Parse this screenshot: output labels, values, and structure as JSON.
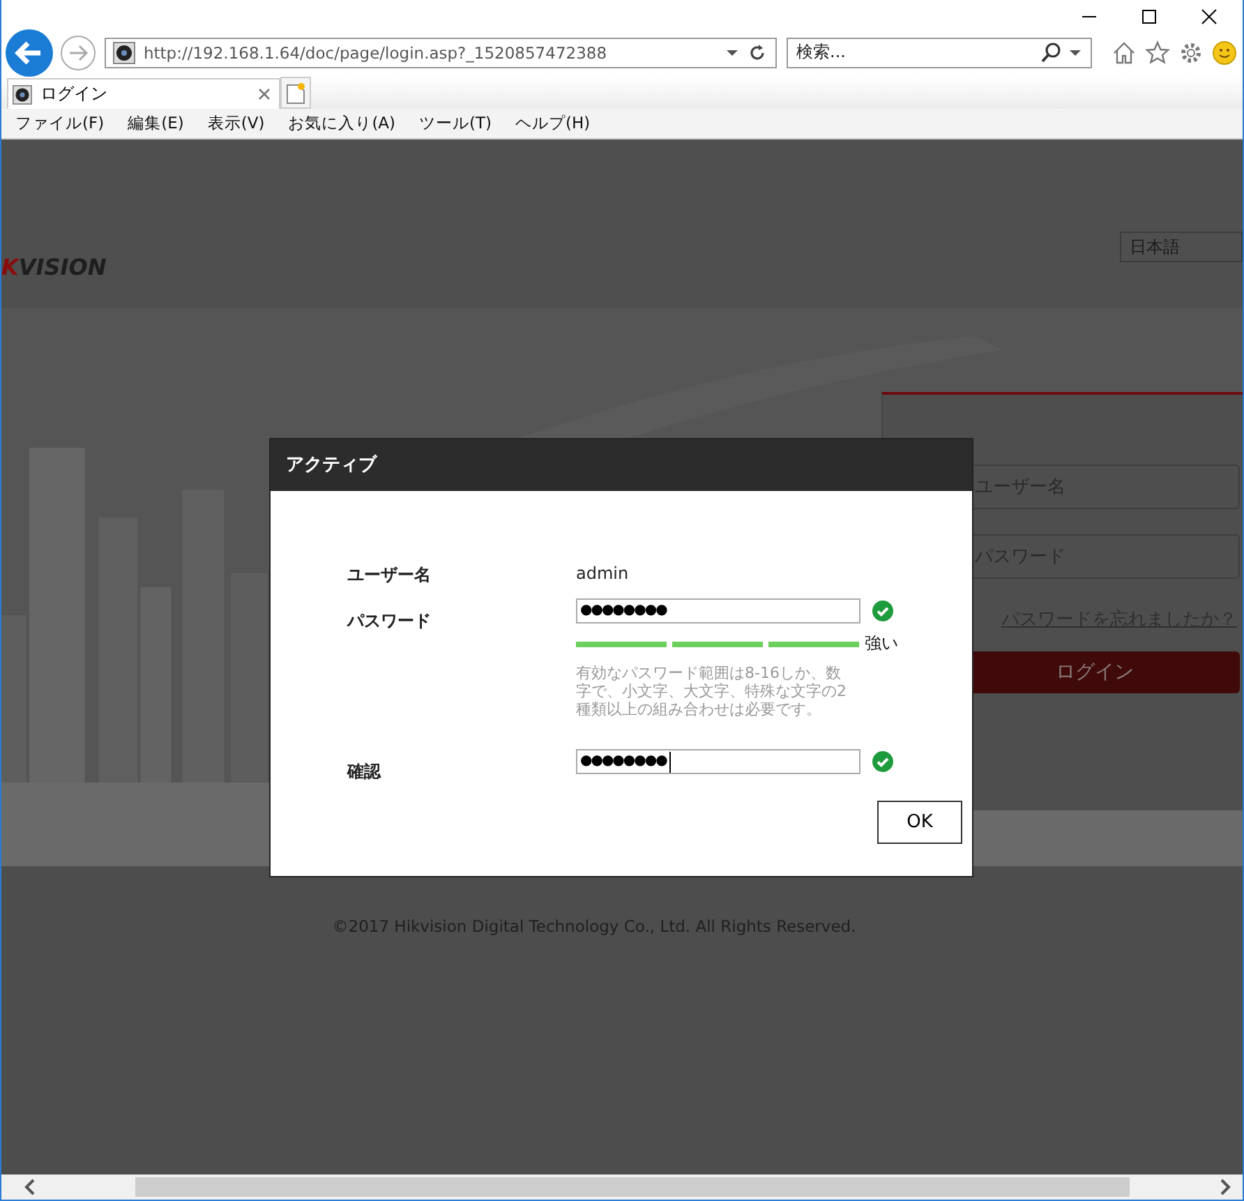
{
  "browser": {
    "url": "http://192.168.1.64/doc/page/login.asp?_1520857472388",
    "search": {
      "placeholder": "検索..."
    },
    "tabs": [
      {
        "title": "ログイン",
        "selected": true
      }
    ],
    "menu": [
      "ファイル(F)",
      "編集(E)",
      "表示(V)",
      "お気に入り(A)",
      "ツール(T)",
      "ヘルプ(H)"
    ]
  },
  "page": {
    "logo": "KVISION",
    "language": "日本語",
    "login": {
      "username_placeholder": "ユーザー名",
      "password_placeholder": "パスワード",
      "forgot_link": "パスワードを忘れましたか？",
      "login_button": "ログイン"
    },
    "footer": "©2017 Hikvision Digital Technology Co., Ltd. All Rights Reserved."
  },
  "dialog": {
    "title": "アクティブ",
    "fields": [
      {
        "kind": "text",
        "label": "ユーザー名",
        "value": "admin"
      },
      {
        "kind": "password",
        "label": "パスワード",
        "value": "●●●●●●●●",
        "valid": true,
        "strength": {
          "level": 1,
          "label": "強い"
        },
        "hint": "有効なパスワード範囲は8-16しか、数字で、小文字、大文字、特殊な文字の2種類以上の組み合わせは必要です。"
      },
      {
        "kind": "password",
        "label": "確認",
        "value": "●●●●●●●●",
        "valid": true,
        "focused": true
      }
    ],
    "ok_button": "OK"
  }
}
